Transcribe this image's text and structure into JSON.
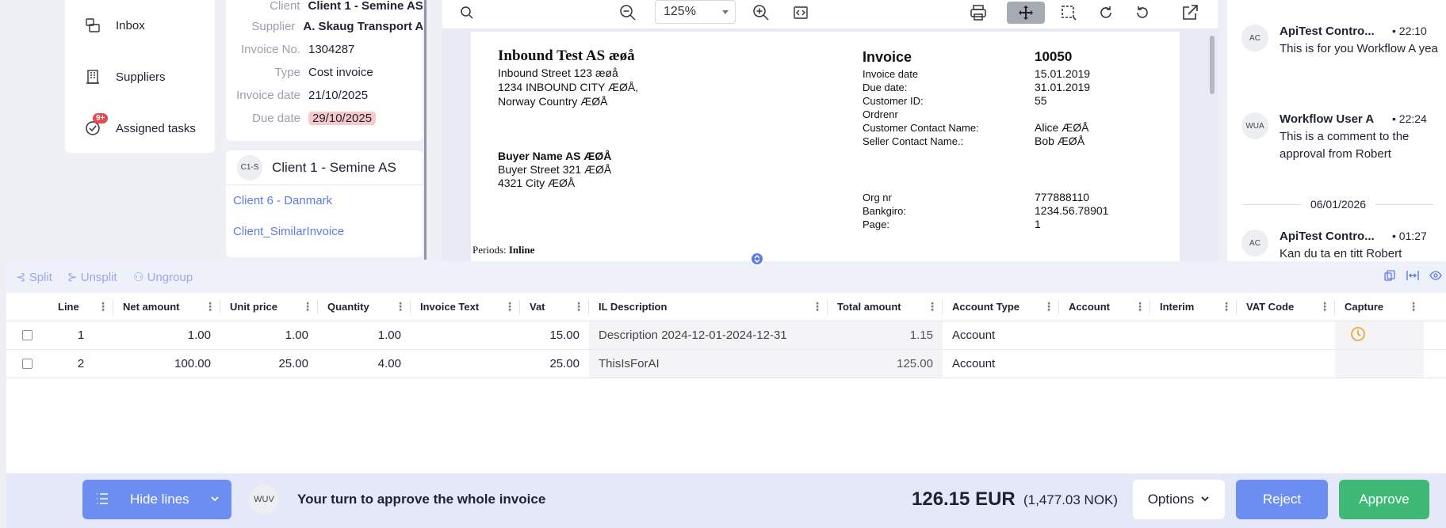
{
  "nav": {
    "items": [
      {
        "label": "Inbox",
        "icon": "inbox-icon"
      },
      {
        "label": "Suppliers",
        "icon": "building-icon"
      },
      {
        "label": "Assigned tasks",
        "icon": "check-circle-icon",
        "badge": "9+"
      }
    ]
  },
  "invoice_info": {
    "client_label": "Client",
    "client_value": "Client 1 - Semine AS",
    "supplier_label": "Supplier",
    "supplier_value": "A. Skaug Transport AS",
    "invoice_no_label": "Invoice No.",
    "invoice_no_value": "1304287",
    "type_label": "Type",
    "type_value": "Cost invoice",
    "invoice_date_label": "Invoice date",
    "invoice_date_value": "21/10/2025",
    "due_date_label": "Due date",
    "due_date_value": "29/10/2025",
    "due_color": "#f8c9cc"
  },
  "client_panel": {
    "avatar": "C1-S",
    "name": "Client 1 - Semine AS",
    "links": [
      "Client 6 - Danmark",
      "Client_SimilarInvoice"
    ]
  },
  "viewer": {
    "zoom": "125%",
    "document": {
      "company": "Inbound Test AS æøå",
      "address": [
        "Inbound Street 123 æøå",
        "1234 INBOUND CITY ÆØÅ,",
        "Norway Country ÆØÅ"
      ],
      "buyer_name": "Buyer Name AS ÆØÅ",
      "buyer_address": [
        "Buyer Street 321 ÆØÅ",
        "4321 City ÆØÅ"
      ],
      "invoice_heading": "Invoice",
      "invoice_number": "10050",
      "fields": [
        {
          "label": "Invoice date",
          "value": "15.01.2019"
        },
        {
          "label": "Due date:",
          "value": "31.01.2019"
        },
        {
          "label": "Customer ID:",
          "value": "55"
        },
        {
          "label": "Ordrenr",
          "value": ""
        },
        {
          "label": "Customer Contact Name:",
          "value": "Alice ÆØÅ"
        },
        {
          "label": "Seller Contact Name.:",
          "value": "Bob ÆØÅ"
        }
      ],
      "fields2": [
        {
          "label": "Org nr",
          "value": "777888110"
        },
        {
          "label": "Bankgiro:",
          "value": "1234.56.78901"
        },
        {
          "label": "Page:",
          "value": "1"
        }
      ],
      "periods_label": "Periods:",
      "periods_value": "Inline"
    }
  },
  "comments": [
    {
      "avatar": "AC",
      "author": "ApiTest Contro...",
      "time": "22:10",
      "text": "This is for you Workflow A yea"
    },
    {
      "avatar": "WUA",
      "author": "Workflow User A",
      "time": "22:24",
      "text": "This is a comment to the approval from Robert"
    },
    {
      "avatar": "AC",
      "author": "ApiTest Contro...",
      "time": "01:27",
      "text": "Kan du ta en titt Robert"
    }
  ],
  "comments_date": "06/01/2026",
  "lines_toolbar": {
    "split": "Split",
    "unsplit": "Unsplit",
    "ungroup": "Ungroup"
  },
  "table": {
    "headers": [
      "Line",
      "Net amount",
      "Unit price",
      "Quantity",
      "Invoice Text",
      "Vat",
      "IL Description",
      "Total amount",
      "Account Type",
      "Account",
      "Interim",
      "VAT Code",
      "Capture"
    ],
    "rows": [
      {
        "line": "1",
        "net": "1.00",
        "unit": "1.00",
        "qty": "1.00",
        "text": "",
        "vat": "15.00",
        "desc": "Description 2024-12-01-2024-12-31",
        "total": "1.15",
        "acctype": "Account",
        "account": "",
        "interim": "",
        "vatcode": "",
        "capture": "clock-icon"
      },
      {
        "line": "2",
        "net": "100.00",
        "unit": "25.00",
        "qty": "4.00",
        "text": "",
        "vat": "25.00",
        "desc": "ThisIsForAI",
        "total": "125.00",
        "acctype": "Account",
        "account": "",
        "interim": "",
        "vatcode": "",
        "capture": ""
      }
    ]
  },
  "footer": {
    "hide_lines": "Hide lines",
    "avatar": "WUV",
    "turn_text": "Your turn to approve the whole invoice",
    "total": "126.15 EUR",
    "total_nok": "(1,477.03 NOK)",
    "options": "Options",
    "reject": "Reject",
    "approve": "Approve"
  },
  "colors": {
    "accent": "#6c8ef0",
    "approve": "#3fba76",
    "link": "#5b7be6",
    "badge": "#e5484d"
  }
}
